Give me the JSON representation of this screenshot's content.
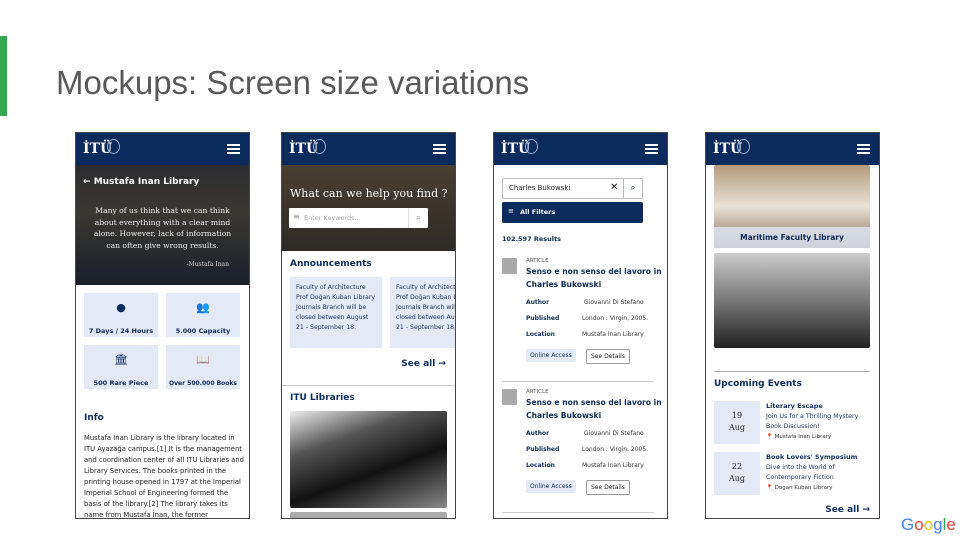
{
  "slide": {
    "title": "Mockups: Screen size variations",
    "brand_logo": "Google",
    "accent_color": "#34a853"
  },
  "app": {
    "logo": "İTÜ",
    "nav_color": "#0b2b5c"
  },
  "phone1": {
    "title": "Mustafa Inan Library",
    "quote": [
      "Many of us think that we can think",
      "about everything with a clear mind",
      "alone. However, lack of information",
      "can often give wrong results."
    ],
    "quote_author": "-Mustafa Inan",
    "tiles": [
      {
        "icon": "clock-icon",
        "label": "7 Days / 24 Hours"
      },
      {
        "icon": "people-icon",
        "label": "5.000 Capacity"
      },
      {
        "icon": "museum-icon",
        "label": "500 Rare Piece"
      },
      {
        "icon": "book-icon",
        "label": "Over 500.000 Books"
      }
    ],
    "info_heading": "Info",
    "info_text": "Mustafa İnan Library is the library located in ITU Ayazağa campus.[1] It is the management and coordination center of all ITU Libraries and Library Services. The books printed in the printing house opened in 1797 at the Imperial Imperial School of Engineering formed the basis of the library.[2] The library takes its name from Mustafa İnan, the former"
  },
  "phone2": {
    "hero_title": "What can we help you find ?",
    "search_placeholder": "Enter Keywords...",
    "announcements_heading": "Announcements",
    "announcements": [
      "Faculty of Architecture Prof Doğan Kuban Library Journals Branch will be closed between August 21 - September 18.",
      "Faculty of Architecture Prof Doğan Kuban Library Journals Branch will be closed between August 21 - September 18."
    ],
    "see_all": "See all →",
    "libraries_heading": "ITU Libraries"
  },
  "phone3": {
    "search_value": "Charles Bukowski",
    "filters_label": "All Filters",
    "results_count": "102.597 Results",
    "results": [
      {
        "type": "ARTICLE",
        "title": [
          "Senso e non senso del lavoro in",
          "Charles Bukowski"
        ],
        "author_label": "Author",
        "author": "Giovanni Di Stefano",
        "published_label": "Published",
        "published": "London : Virgin, 2005.",
        "location_label": "Location",
        "location": "Mustafa Inan Library",
        "online": "Online Access",
        "details": "See Details"
      },
      {
        "type": "ARTICLE",
        "title": [
          "Senso e non senso del lavoro in",
          "Charles Bukowski"
        ],
        "author_label": "Author",
        "author": "Giovanni Di Stefano",
        "published_label": "Published",
        "published": "London : Virgin, 2005.",
        "location_label": "Location",
        "location": "Mustafa Inan Library",
        "online": "Online Access",
        "details": "See Details"
      }
    ]
  },
  "phone4": {
    "library_caption": "Maritime Faculty Library",
    "events_heading": "Upcoming Events",
    "events": [
      {
        "day": "19",
        "month": "Aug",
        "title": "Literary Escape",
        "desc": [
          "Join Us for a Thrilling Mystery",
          "Book Discussion!"
        ],
        "location": "Mustafa Inan Library"
      },
      {
        "day": "22",
        "month": "Aug",
        "title": "Book Lovers' Symposium",
        "desc": [
          "Dive into the World of",
          "Contemporary Fiction"
        ],
        "location": "Dogan Kuban Library"
      }
    ],
    "see_all": "See all →"
  }
}
